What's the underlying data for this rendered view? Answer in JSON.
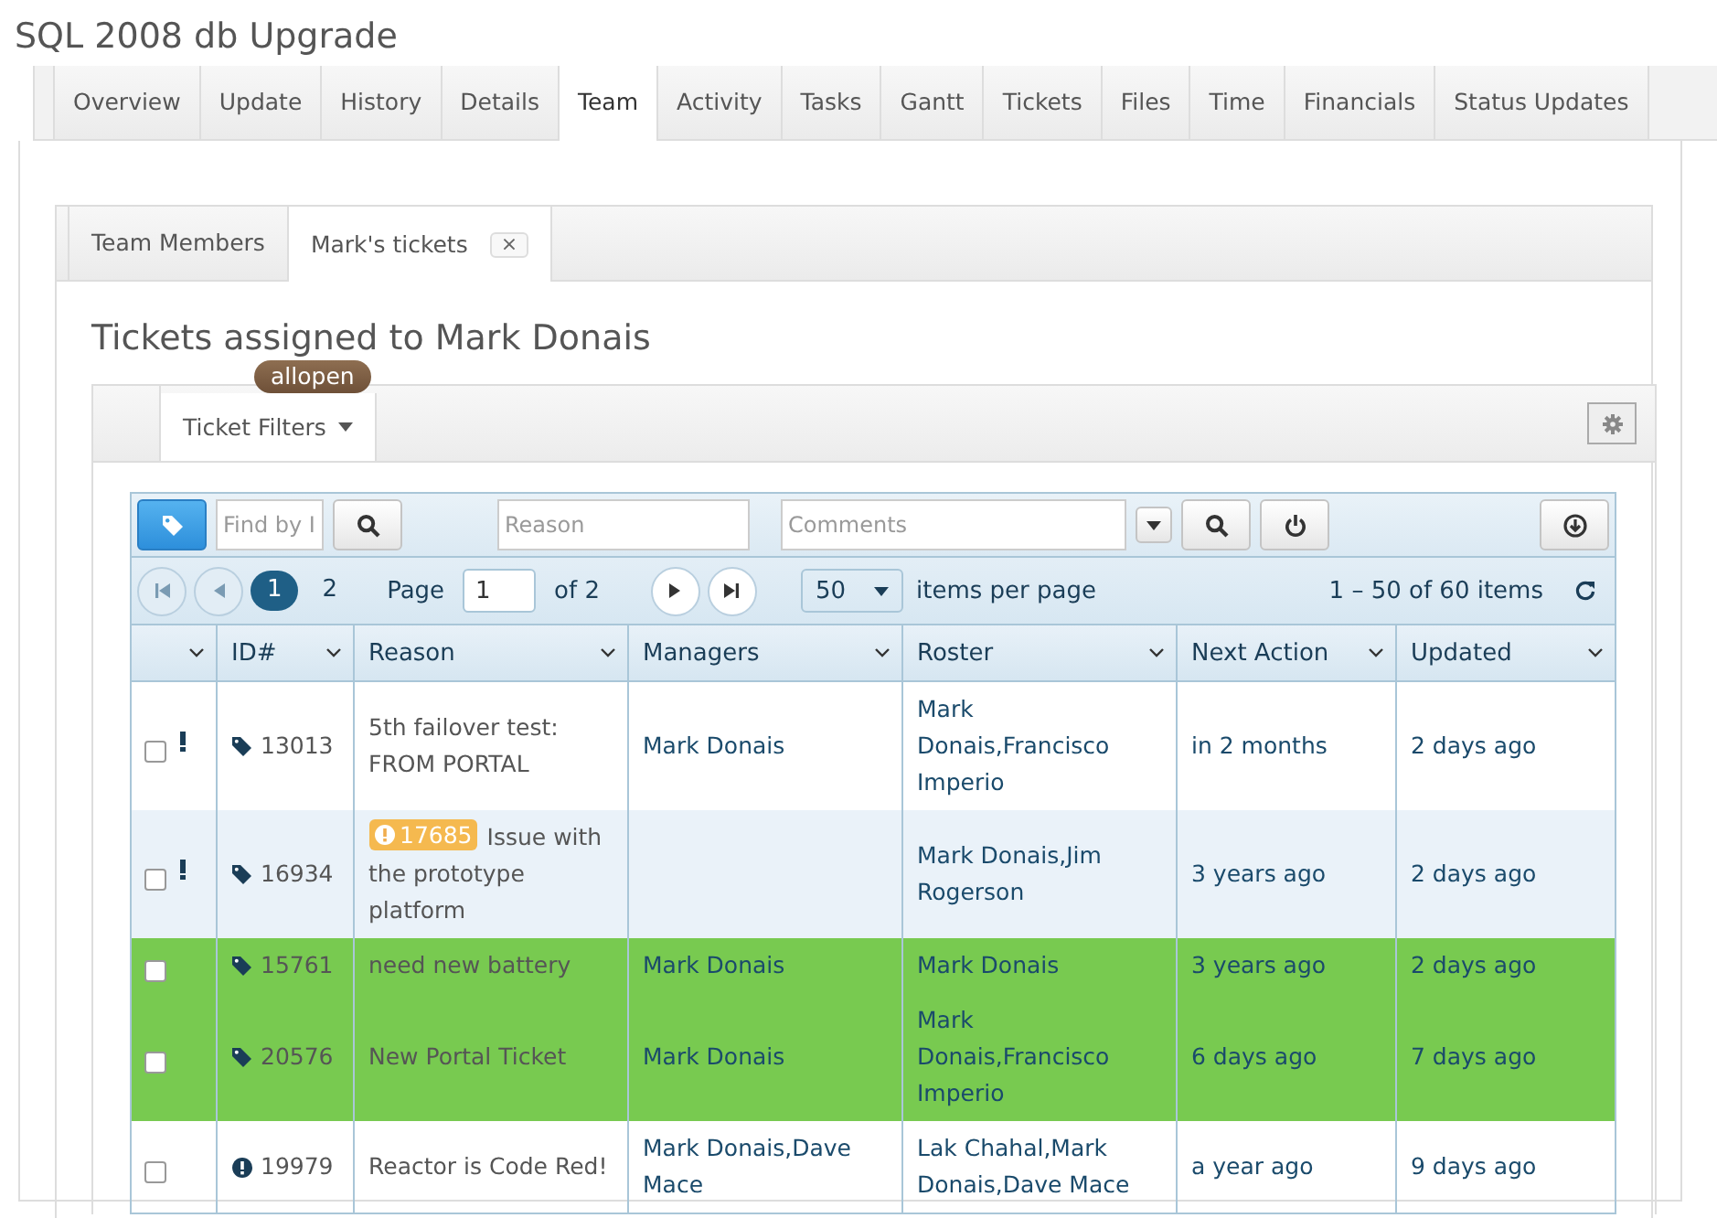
{
  "page_title": "SQL 2008 db Upgrade",
  "tabs": [
    {
      "label": "Overview",
      "selected": false
    },
    {
      "label": "Update",
      "selected": false
    },
    {
      "label": "History",
      "selected": false
    },
    {
      "label": "Details",
      "selected": false
    },
    {
      "label": "Team",
      "selected": true
    },
    {
      "label": "Activity",
      "selected": false
    },
    {
      "label": "Tasks",
      "selected": false
    },
    {
      "label": "Gantt",
      "selected": false
    },
    {
      "label": "Tickets",
      "selected": false
    },
    {
      "label": "Files",
      "selected": false
    },
    {
      "label": "Time",
      "selected": false
    },
    {
      "label": "Financials",
      "selected": false
    },
    {
      "label": "Status Updates",
      "selected": false
    }
  ],
  "subtabs": [
    {
      "label": "Team Members",
      "selected": false,
      "closable": false
    },
    {
      "label": "Mark's tickets",
      "selected": true,
      "closable": true
    }
  ],
  "close_label": "×",
  "heading": "Tickets assigned to Mark Donais",
  "filter_tab": {
    "label": "Ticket Filters",
    "badge": "allopen"
  },
  "toolbar": {
    "find_placeholder": "Find by I",
    "reason_placeholder": "Reason",
    "comments_placeholder": "Comments"
  },
  "pager": {
    "pages": [
      {
        "label": "1",
        "selected": true
      },
      {
        "label": "2",
        "selected": false
      }
    ],
    "page_label": "Page",
    "page_value": "1",
    "of_label": "of 2",
    "per_page": "50",
    "per_page_label": "items per page",
    "summary": "1 – 50 of 60 items"
  },
  "columns": [
    "ID#",
    "Reason",
    "Managers",
    "Roster",
    "Next Action",
    "Updated"
  ],
  "rows": [
    {
      "checked": false,
      "flagged": true,
      "kind": "tag",
      "id": "13013",
      "badge": null,
      "reason": "5th failover test: FROM PORTAL",
      "managers": "Mark Donais",
      "roster": "Mark Donais,Francisco Imperio",
      "next_action": "in 2 months",
      "updated": "2 days ago",
      "highlighted": false
    },
    {
      "checked": false,
      "flagged": true,
      "kind": "tag",
      "id": "16934",
      "badge": "17685",
      "reason": "Issue with the prototype platform",
      "managers": "",
      "roster": "Mark Donais,Jim Rogerson",
      "next_action": "3 years ago",
      "updated": "2 days ago",
      "highlighted": false
    },
    {
      "checked": false,
      "flagged": false,
      "kind": "tag",
      "id": "15761",
      "badge": null,
      "reason": "need new battery",
      "managers": "Mark Donais",
      "roster": "Mark Donais",
      "next_action": "3 years ago",
      "updated": "2 days ago",
      "highlighted": true
    },
    {
      "checked": false,
      "flagged": false,
      "kind": "tag",
      "id": "20576",
      "badge": null,
      "reason": "New Portal Ticket",
      "managers": "Mark Donais",
      "roster": "Mark Donais,Francisco Imperio",
      "next_action": "6 days ago",
      "updated": "7 days ago",
      "highlighted": true
    },
    {
      "checked": false,
      "flagged": false,
      "kind": "alert",
      "id": "19979",
      "badge": null,
      "reason": "Reactor is Code Red!",
      "managers": "Mark Donais,Dave Mace",
      "roster": "Lak Chahal,Mark Donais,Dave Mace",
      "next_action": "a year ago",
      "updated": "9 days ago",
      "highlighted": false
    }
  ]
}
